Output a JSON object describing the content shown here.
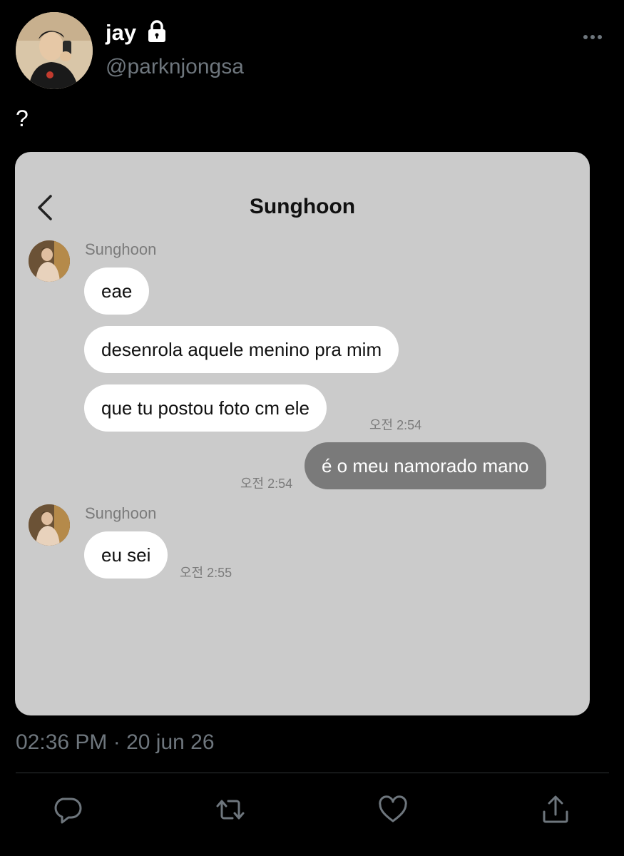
{
  "tweet": {
    "display_name": "jay",
    "handle": "@parknjongsa",
    "text": "?",
    "timestamp": "02:36 PM · 20 jun 26",
    "protected_icon": "lock-icon",
    "more_icon": "more-dots-icon"
  },
  "chat": {
    "title": "Sunghoon",
    "back_icon": "chevron-left-icon",
    "messages": [
      {
        "sender": "Sunghoon",
        "text": "eae",
        "type": "received"
      },
      {
        "text": "desenrola aquele menino pra mim",
        "type": "received"
      },
      {
        "text": "que tu postou foto cm ele",
        "type": "received",
        "time": "오전 2:54"
      },
      {
        "text": "é o meu namorado mano",
        "type": "sent",
        "time": "오전 2:54"
      },
      {
        "sender": "Sunghoon",
        "text": "eu sei",
        "type": "received",
        "time": "오전 2:55"
      }
    ]
  },
  "actions": {
    "icons": [
      "reply-icon",
      "retweet-icon",
      "like-icon",
      "share-icon"
    ]
  },
  "colors": {
    "background": "#000000",
    "secondary_text": "#6e767d",
    "card_background": "#cbcbcb",
    "sent_bubble": "#7a7a7a",
    "received_bubble": "#ffffff"
  }
}
